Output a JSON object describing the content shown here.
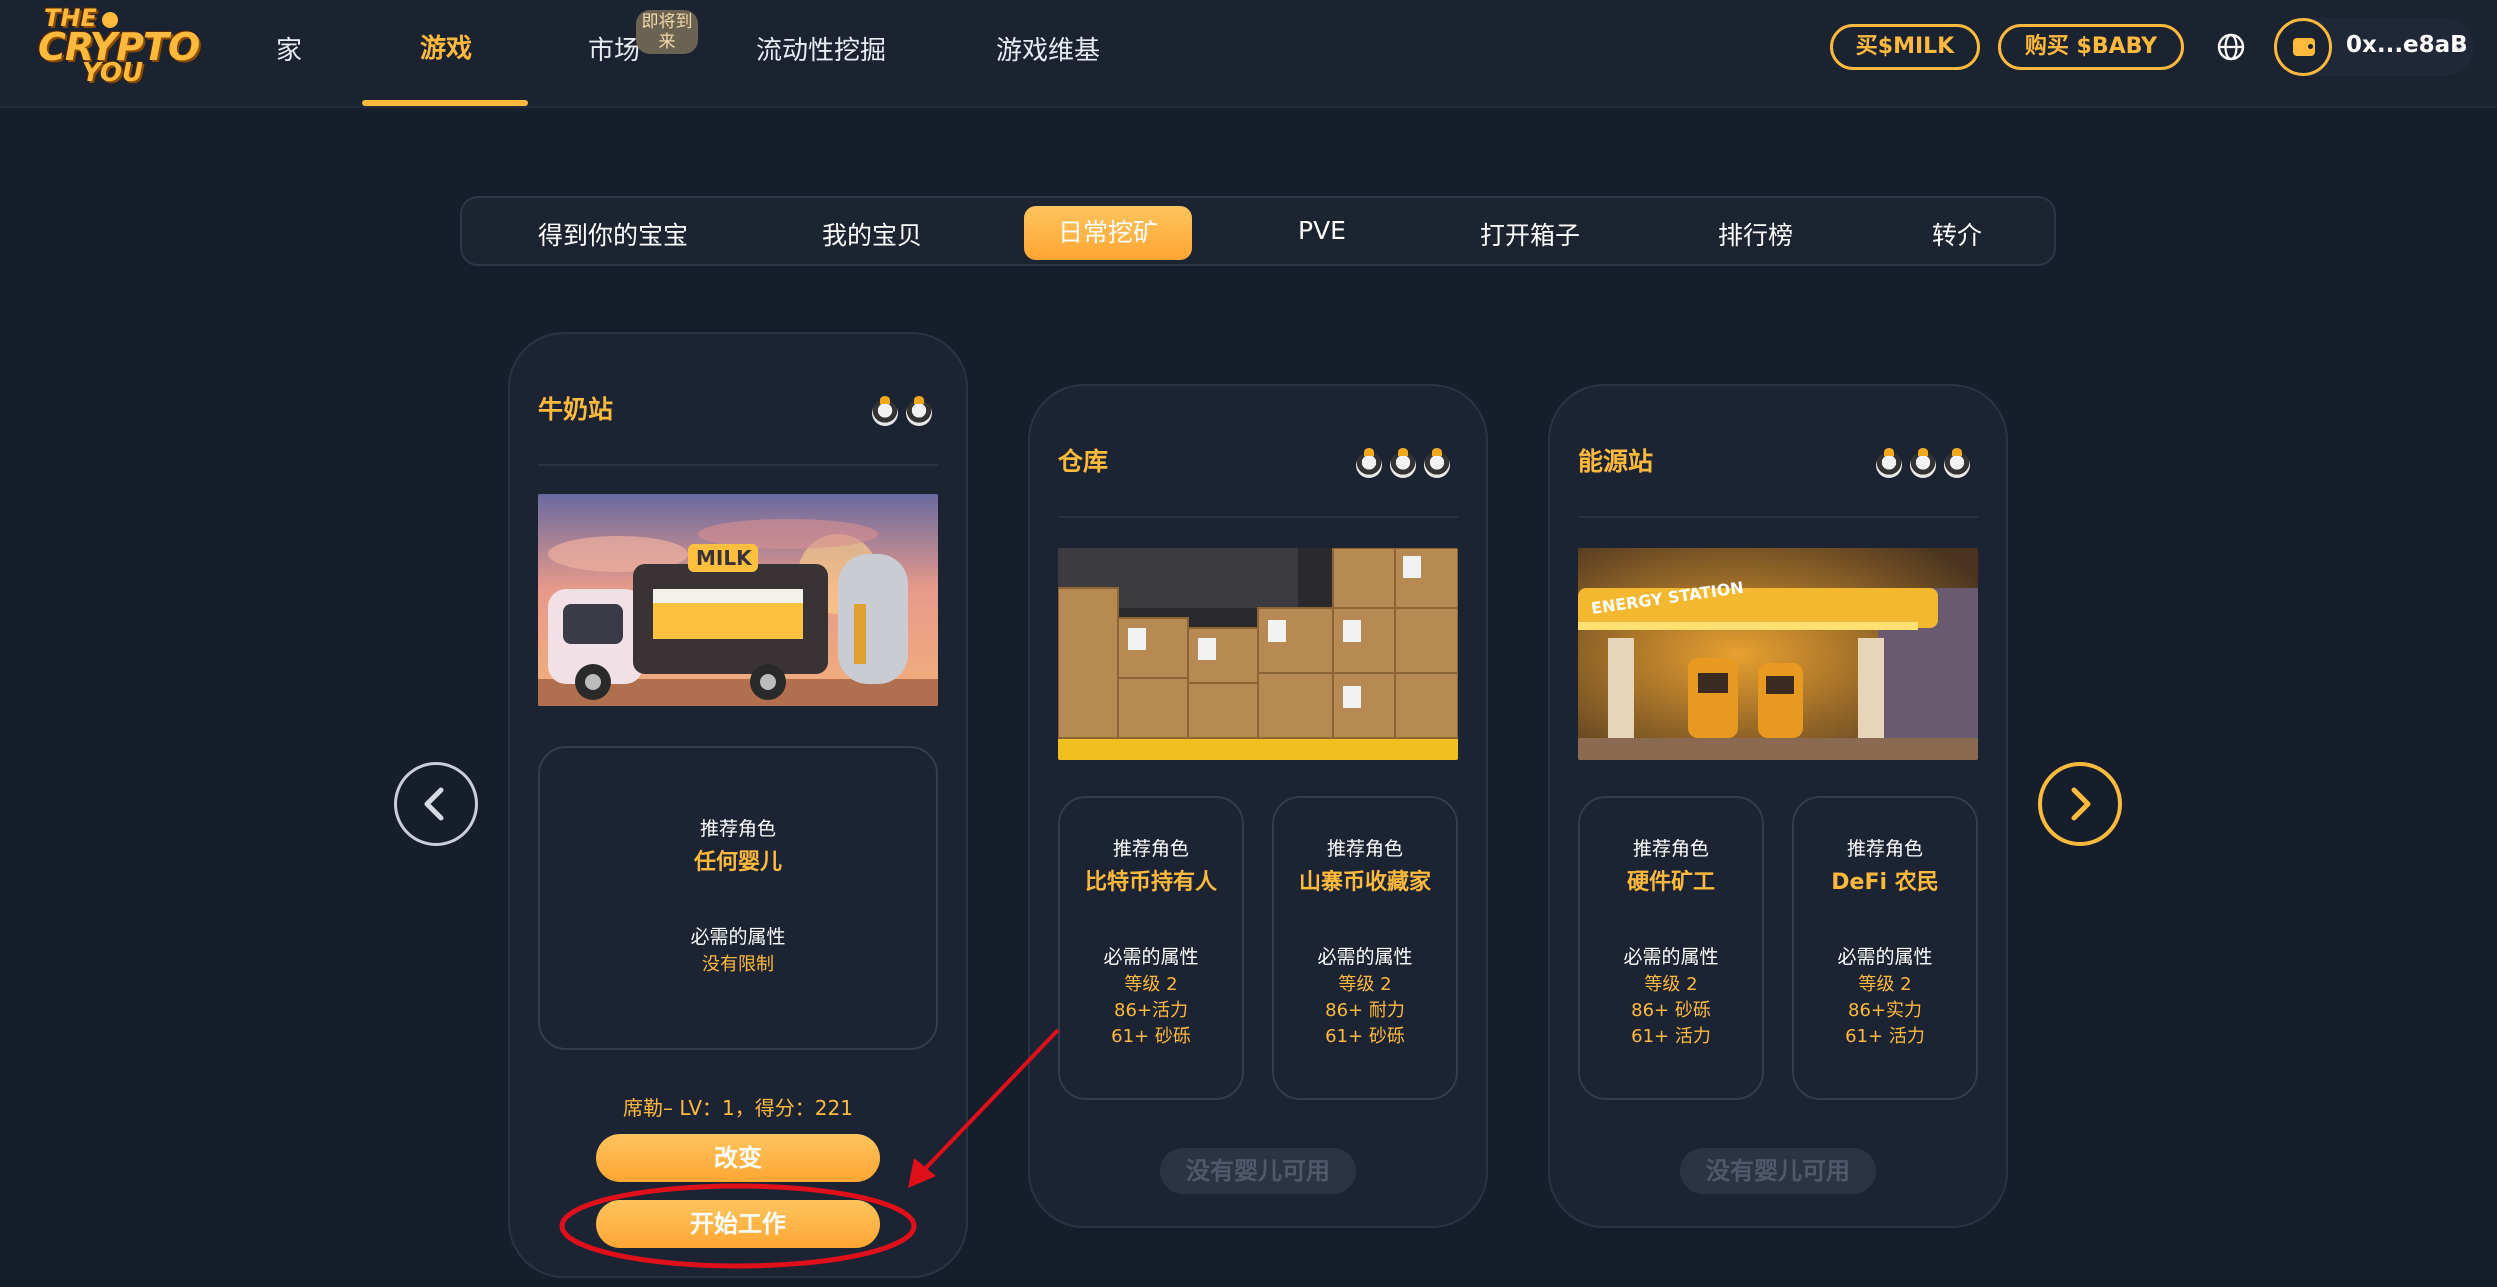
{
  "brand": {
    "logo_line1": "THE",
    "logo_line2": "CRYPTO",
    "logo_line3": "YOU"
  },
  "nav": {
    "items": [
      {
        "label": "家"
      },
      {
        "label": "游戏",
        "active": true
      },
      {
        "label": "市场",
        "badge": "即将到来"
      },
      {
        "label": "流动性挖掘"
      },
      {
        "label": "游戏维基"
      }
    ],
    "buy_milk": "买$MILK",
    "buy_baby": "购买 $BABY",
    "wallet_address": "0x...e8aB"
  },
  "subtabs": [
    {
      "label": "得到你的宝宝"
    },
    {
      "label": "我的宝贝"
    },
    {
      "label": "日常挖矿",
      "active": true
    },
    {
      "label": "PVE"
    },
    {
      "label": "打开箱子"
    },
    {
      "label": "排行榜"
    },
    {
      "label": "转介"
    }
  ],
  "cards": [
    {
      "title": "牛奶站",
      "baby_count": 2,
      "image": "milk-truck-image",
      "roles": [
        {
          "label": "推荐角色",
          "role": "任何婴儿",
          "attr_label": "必需的属性",
          "attrs": [
            "没有限制"
          ]
        }
      ],
      "status": "席勒– LV：1，得分：221",
      "change_button": "改变",
      "start_button": "开始工作"
    },
    {
      "title": "仓库",
      "baby_count": 3,
      "image": "warehouse-boxes-image",
      "roles": [
        {
          "label": "推荐角色",
          "role": "比特币持有人",
          "attr_label": "必需的属性",
          "attrs": [
            "等级 2",
            "86+活力",
            "61+ 砂砾"
          ]
        },
        {
          "label": "推荐角色",
          "role": "山寨币收藏家",
          "attr_label": "必需的属性",
          "attrs": [
            "等级 2",
            "86+ 耐力",
            "61+ 砂砾"
          ]
        }
      ],
      "disabled_button": "没有婴儿可用"
    },
    {
      "title": "能源站",
      "baby_count": 3,
      "image": "energy-station-image",
      "roles": [
        {
          "label": "推荐角色",
          "role": "硬件矿工",
          "attr_label": "必需的属性",
          "attrs": [
            "等级 2",
            "86+ 砂砾",
            "61+ 活力"
          ]
        },
        {
          "label": "推荐角色",
          "role": "DeFi 农民",
          "attr_label": "必需的属性",
          "attrs": [
            "等级 2",
            "86+实力",
            "61+ 活力"
          ]
        }
      ],
      "disabled_button": "没有婴儿可用"
    }
  ],
  "icons": {
    "prev": "chevron-left-icon",
    "next": "chevron-right-icon",
    "language": "globe-icon",
    "wallet": "wallet-icon",
    "account_menu": "chevron-down-icon"
  },
  "colors": {
    "accent": "#ffb93c",
    "background": "#161d2b",
    "card": "#1c2433",
    "annotation": "#e0101a"
  }
}
